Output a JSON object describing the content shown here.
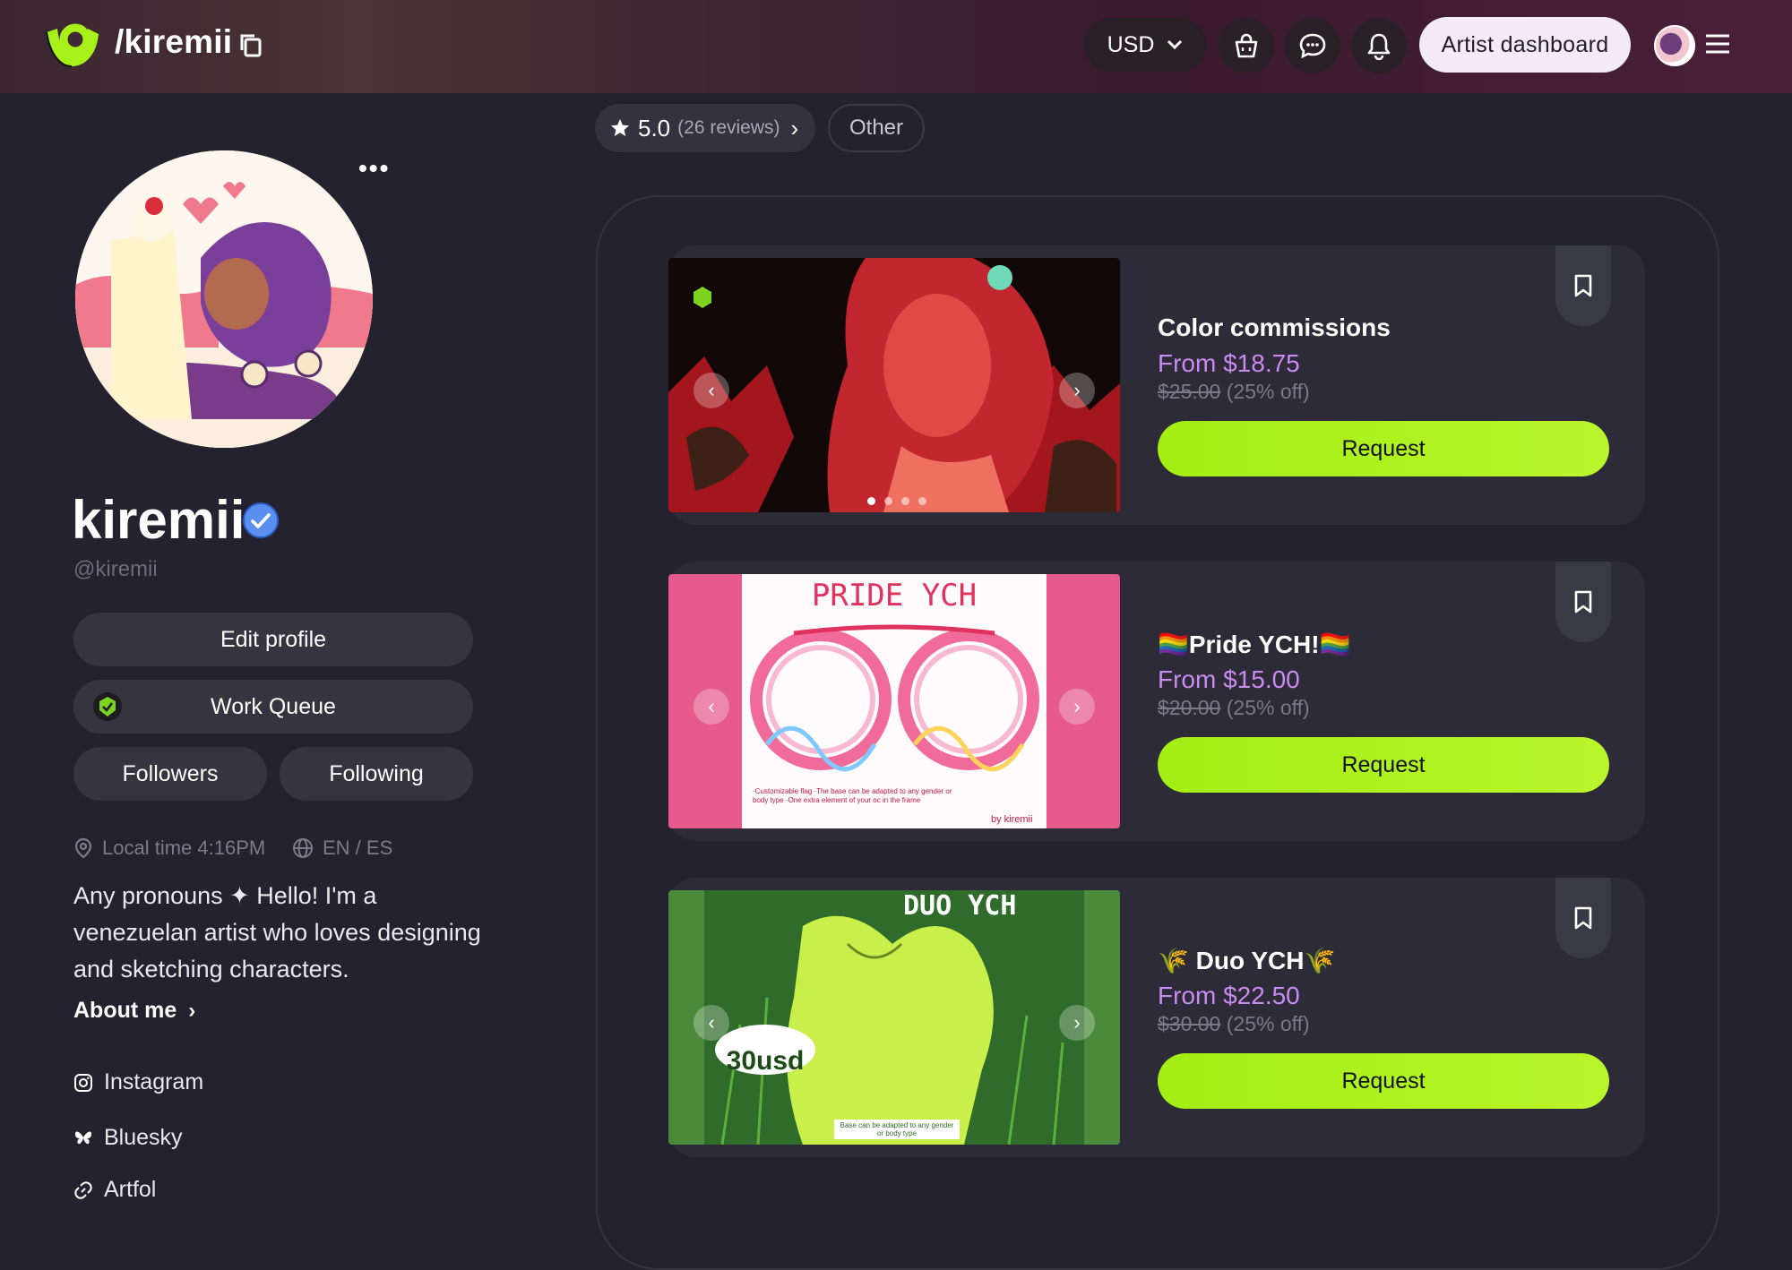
{
  "header": {
    "handle": "/kiremii",
    "currency": "USD",
    "artist_dashboard": "Artist dashboard"
  },
  "profile": {
    "display_name": "kiremii",
    "username": "@kiremii",
    "edit_profile": "Edit profile",
    "work_queue": "Work Queue",
    "followers": "Followers",
    "following": "Following",
    "local_time": "Local time 4:16PM",
    "languages": "EN / ES",
    "bio": "Any pronouns ✦ Hello! I'm a venezuelan artist who loves designing and sketching characters.",
    "about_me": "About me",
    "links": [
      {
        "label": "Instagram",
        "icon": "instagram-icon"
      },
      {
        "label": "Bluesky",
        "icon": "butterfly-icon"
      },
      {
        "label": "Artfol",
        "icon": "link-icon"
      }
    ]
  },
  "filters": {
    "rating": "5.0",
    "reviews": "(26 reviews)",
    "other": "Other"
  },
  "commissions": [
    {
      "title": "Color commissions",
      "price": "From $18.75",
      "old_price": "$25.00",
      "discount": "(25% off)",
      "request": "Request"
    },
    {
      "title": "🏳️‍🌈Pride YCH!🏳️‍🌈",
      "price": "From $15.00",
      "old_price": "$20.00",
      "discount": "(25% off)",
      "request": "Request",
      "thumb_heading": "PRIDE YCH",
      "thumb_note": "·Customizable flag ·The base can be adapted to any gender or body type ·One extra element of your oc in the frame",
      "thumb_signature": "by kiremii"
    },
    {
      "title": "🌾 Duo YCH🌾",
      "price": "From $22.50",
      "old_price": "$30.00",
      "discount": "(25% off)",
      "request": "Request",
      "thumb_heading": "DUO YCH",
      "thumb_badge": "30usd",
      "thumb_note": "Base can be adapted to any gender or body type"
    }
  ],
  "colors": {
    "accent_green": "#a8f01a",
    "price_purple": "#c98bf0",
    "background": "#23222e"
  }
}
